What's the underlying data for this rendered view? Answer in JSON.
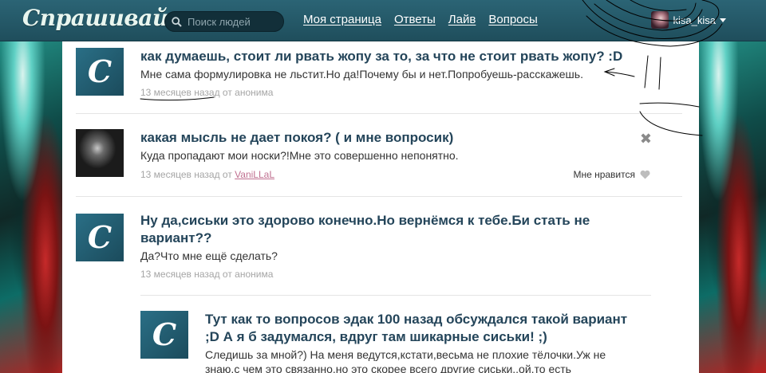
{
  "header": {
    "logo": "Спрашивай.ру",
    "search_placeholder": "Поиск людей",
    "nav": [
      "Моя страница",
      "Ответы",
      "Лайв",
      "Вопросы"
    ],
    "username": "kisa_kisa"
  },
  "items": [
    {
      "title": "как думаешь, стоит ли рвать жопу за то, за что не стоит рвать жопу? :D",
      "body": "Мне сама формулировка не льстит.Но да!Почему бы и нет.Попробуешь-расскажешь.",
      "time": "13 месяцев назад",
      "from": "от",
      "author": "анонима"
    },
    {
      "title": "какая мысль не дает покоя? ( и мне вопросик)",
      "body": "Куда пропадают мои носки?!Мне это совершенно непонятно.",
      "time": "13 месяцев назад",
      "from": "от",
      "author": "VaniLLaL",
      "like": "Мне нравится",
      "close": "✖"
    },
    {
      "title_line1": "Ну да,сиськи это здорово конечно.Но вернёмся к тебе.Би стать не",
      "title_line2": "вариант??",
      "body": "Да?Что мне ещё сделать?",
      "time": "13 месяцев назад",
      "from": "от",
      "author": "анонима"
    },
    {
      "title_line1": "Тут как то вопросов эдак 100 назад обсуждался такой вариант",
      "title_line2": ";D А я б задумался, вдруг там шикарные сиськи! ;)",
      "body_line1": "Следишь за мной?) На меня ведутся,кстати,весьма не плохие тёлочки.Уж не",
      "body_line2": "знаю,с чем это связанно,но это скорее всего другие сиськи..ой,то есть"
    }
  ],
  "avatar_letter": "C",
  "colors": {
    "header": "#245867",
    "title": "#24455a",
    "meta": "#a5a5a5",
    "author_link": "#c07090"
  }
}
